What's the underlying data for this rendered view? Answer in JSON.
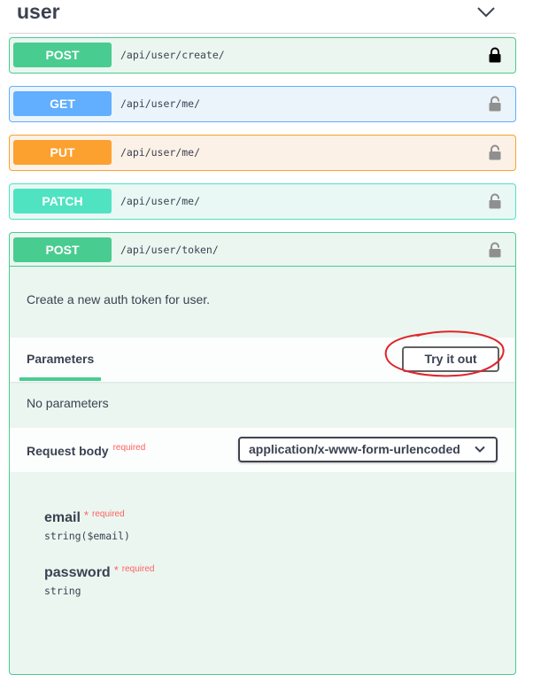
{
  "tag": {
    "title": "user"
  },
  "operations": [
    {
      "method": "POST",
      "path": "/api/user/create/",
      "lock": "locked-padlock-icon"
    },
    {
      "method": "GET",
      "path": "/api/user/me/",
      "lock": "unlocked-padlock-icon"
    },
    {
      "method": "PUT",
      "path": "/api/user/me/",
      "lock": "unlocked-padlock-icon"
    },
    {
      "method": "PATCH",
      "path": "/api/user/me/",
      "lock": "unlocked-padlock-icon"
    },
    {
      "method": "POST",
      "path": "/api/user/token/",
      "lock": "unlocked-padlock-icon"
    }
  ],
  "expanded": {
    "description": "Create a new auth token for user.",
    "parameters_title": "Parameters",
    "try_it_out": "Try it out",
    "no_parameters": "No parameters",
    "request_body_title": "Request body",
    "required_label": "required",
    "content_type": "application/x-www-form-urlencoded",
    "properties": [
      {
        "name": "email",
        "star": "*",
        "required": "required",
        "type": "string($email)"
      },
      {
        "name": "password",
        "star": "*",
        "required": "required",
        "type": "string"
      }
    ]
  },
  "colors": {
    "post": "#49cc90",
    "get": "#61affe",
    "put": "#fca130",
    "patch": "#50e3c2",
    "required": "#ff6060",
    "annotation": "#e0242b"
  }
}
